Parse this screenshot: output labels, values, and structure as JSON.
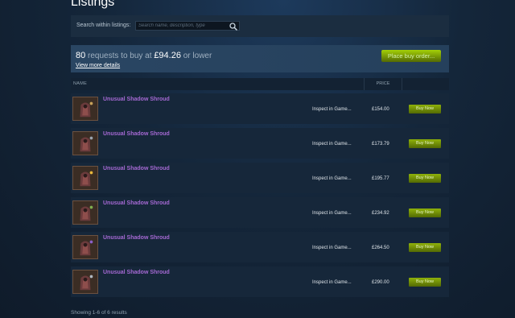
{
  "page": {
    "title": "Listings"
  },
  "search": {
    "label": "Search within listings:",
    "placeholder": "Search name, description, type"
  },
  "buy_order": {
    "count": "80",
    "mid_text": "requests to buy at",
    "price": "£94.26",
    "suffix": "or lower",
    "details_link": "View more details",
    "button": "Place buy order..."
  },
  "table": {
    "headers": {
      "name": "NAME",
      "price": "PRICE"
    },
    "rows": [
      {
        "name": "Unusual Shadow Shroud",
        "inspect": "Inspect in Game...",
        "price": "£154.00",
        "button": "Buy Now",
        "accent": "#c8a25a"
      },
      {
        "name": "Unusual Shadow Shroud",
        "inspect": "Inspect in Game...",
        "price": "£173.79",
        "button": "Buy Now",
        "accent": "#9aa4ae"
      },
      {
        "name": "Unusual Shadow Shroud",
        "inspect": "Inspect in Game...",
        "price": "£195.77",
        "button": "Buy Now",
        "accent": "#e8b73c"
      },
      {
        "name": "Unusual Shadow Shroud",
        "inspect": "Inspect in Game...",
        "price": "£234.92",
        "button": "Buy Now",
        "accent": "#7fae4f"
      },
      {
        "name": "Unusual Shadow Shroud",
        "inspect": "Inspect in Game...",
        "price": "£264.50",
        "button": "Buy Now",
        "accent": "#8a5fc8"
      },
      {
        "name": "Unusual Shadow Shroud",
        "inspect": "Inspect in Game...",
        "price": "£290.00",
        "button": "Buy Now",
        "accent": "#b0b8c0"
      }
    ]
  },
  "footer": {
    "text": "Showing 1-6 of 6 results"
  },
  "colors": {
    "item_name": "#a569d3",
    "buy_button": "#8fb10a",
    "background": "#14263a"
  },
  "icons": {
    "search": "search-icon"
  }
}
